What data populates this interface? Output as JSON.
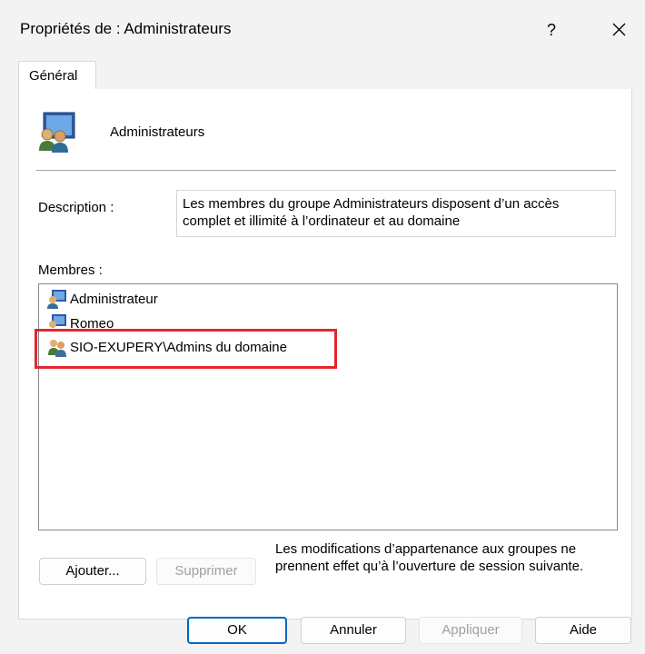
{
  "window": {
    "title": "Propriétés de : Administrateurs",
    "help_label": "?",
    "close_icon": "close-icon"
  },
  "tabs": [
    {
      "label": "Général",
      "selected": true
    }
  ],
  "group": {
    "name": "Administrateurs",
    "icon": "group-users-icon"
  },
  "description": {
    "label": "Description :",
    "value": "Les membres du groupe Administrateurs disposent d’un accès complet et illimité à l’ordinateur et au domaine"
  },
  "members": {
    "label": "Membres :",
    "items": [
      {
        "name": "Administrateur",
        "icon": "user-icon"
      },
      {
        "name": "Romeo",
        "icon": "user-icon"
      },
      {
        "name": "SIO-EXUPERY\\Admins du domaine",
        "icon": "domain-group-icon",
        "highlighted": true
      }
    ],
    "highlight_color": "#e3262e"
  },
  "buttons": {
    "add": "Ajouter...",
    "remove": "Supprimer",
    "ok": "OK",
    "cancel": "Annuler",
    "apply": "Appliquer",
    "help": "Aide"
  },
  "note": "Les modifications d’appartenance aux groupes ne prennent effet qu’à l’ouverture de session suivante.",
  "colors": {
    "accent": "#0067c0",
    "background": "#f3f3f3"
  }
}
